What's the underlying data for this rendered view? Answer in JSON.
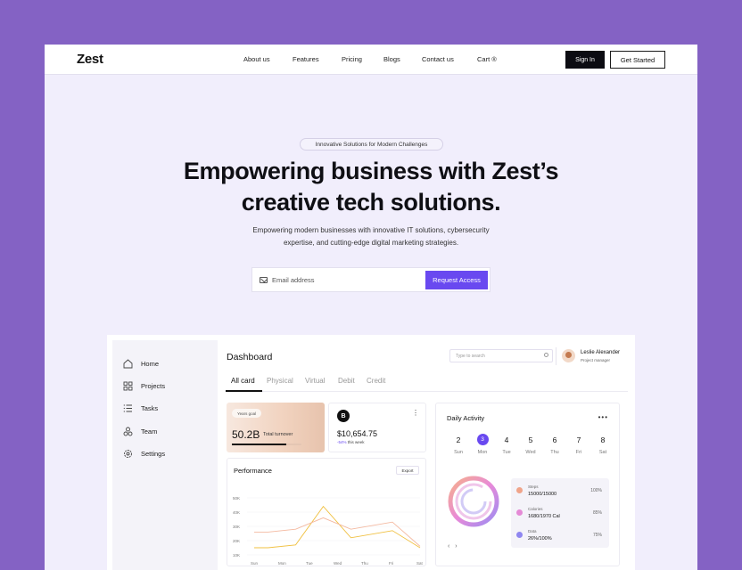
{
  "nav": {
    "logo": "Zest",
    "links": [
      "About us",
      "Features",
      "Pricing",
      "Blogs",
      "Contact us",
      "Cart ®"
    ],
    "sign_in": "Sign In",
    "get_started": "Get Started"
  },
  "hero": {
    "pill": "Innovative Solutions for Modern Challenges",
    "headline_line1": "Empowering business with Zest’s",
    "headline_line2": "creative tech solutions.",
    "sub_line1": "Empowering modern businesses with innovative IT solutions, cybersecurity",
    "sub_line2": "expertise, and cutting-edge digital marketing strategies.",
    "email_placeholder": "Email address",
    "cta": "Request Access"
  },
  "dashboard": {
    "sidebar": [
      "Home",
      "Projects",
      "Tasks",
      "Team",
      "Settings"
    ],
    "title": "Dashboard",
    "search_placeholder": "Type to search",
    "user": {
      "name": "Leslie Alexander",
      "role": "Project manager"
    },
    "tabs": [
      "All card",
      "Physical",
      "Virtual",
      "Debit",
      "Credit"
    ],
    "active_tab": "All card",
    "goal_card": {
      "pill": "Years goal",
      "value": "50.2B",
      "label": "Total turnover",
      "progress": 0.78
    },
    "balance_card": {
      "coin": "B",
      "value": "$10,654.75",
      "change": "-54%",
      "change_label": "this week"
    },
    "daily_activity": {
      "title": "Daily Activity",
      "days": [
        {
          "num": "2",
          "name": "Sun"
        },
        {
          "num": "3",
          "name": "Mon"
        },
        {
          "num": "4",
          "name": "Tue"
        },
        {
          "num": "5",
          "name": "Wed"
        },
        {
          "num": "6",
          "name": "Thu"
        },
        {
          "num": "7",
          "name": "Fri"
        },
        {
          "num": "8",
          "name": "Sat"
        }
      ],
      "selected_day": "3",
      "stats": [
        {
          "name": "Steps",
          "value": "15000/15000",
          "pct": "100%",
          "color": "#f0a48a"
        },
        {
          "name": "Calories",
          "value": "1680/1970 Cal",
          "pct": "85%",
          "color": "#e58ad6"
        },
        {
          "name": "Data",
          "value": "26%/100%",
          "pct": "75%",
          "color": "#8f86f0"
        }
      ]
    },
    "performance": {
      "title": "Performance",
      "export": "Export"
    }
  },
  "chart_data": {
    "type": "line",
    "title": "Performance",
    "categories": [
      "Sun",
      "Mon",
      "Tue",
      "Wed",
      "Thu",
      "Fri",
      "Sat"
    ],
    "y_ticks": [
      "50K",
      "40K",
      "30K",
      "20K",
      "10K"
    ],
    "ylim": [
      10000,
      50000
    ],
    "series": [
      {
        "color": "#f0c040",
        "values": [
          15000,
          15000,
          17000,
          44000,
          22000,
          27000,
          15000
        ]
      },
      {
        "color": "#f4b9a0",
        "values": [
          26000,
          26000,
          28000,
          36000,
          28000,
          33000,
          16000
        ]
      }
    ],
    "x_values": [
      0,
      0.5,
      1.5,
      2.5,
      3.5,
      5,
      6
    ]
  }
}
